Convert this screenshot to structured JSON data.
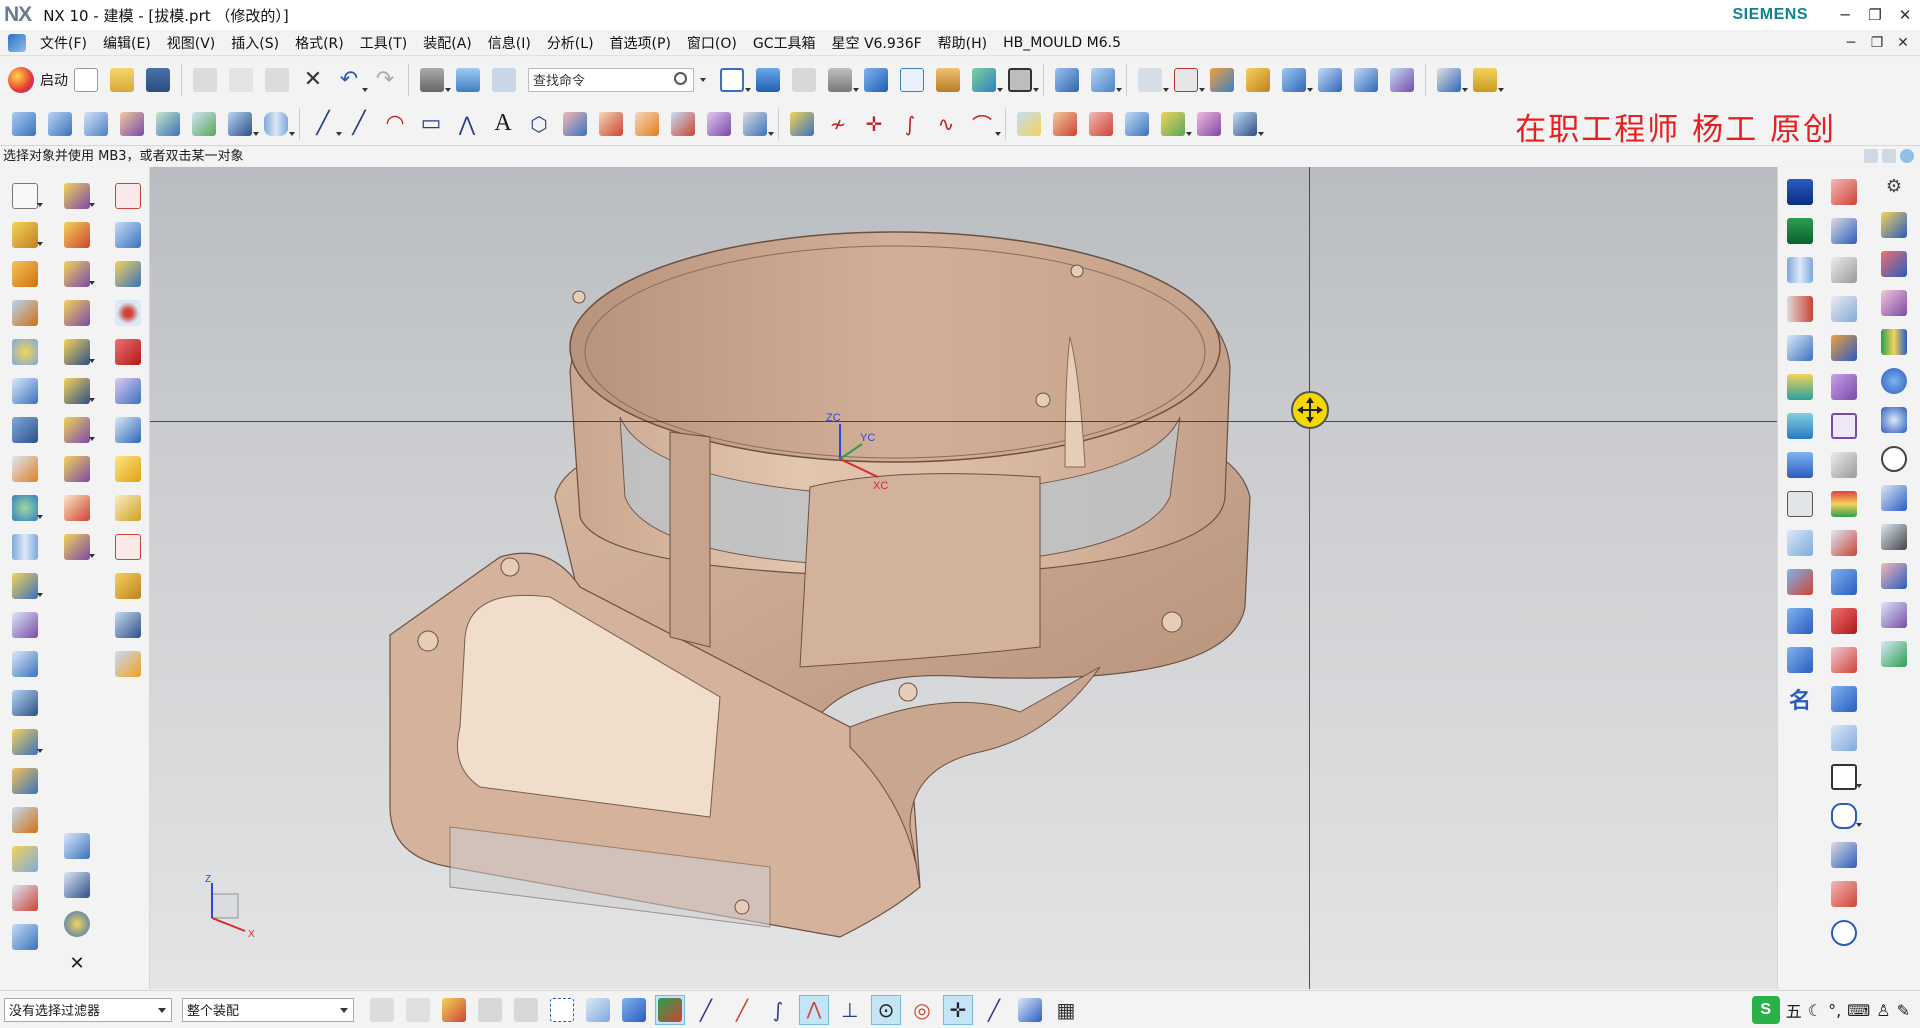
{
  "app": {
    "logo": "NX",
    "window_title": "NX 10 - 建模 - [拔模.prt （修改的）]",
    "brand": "SIEMENS",
    "brand_color": "#10858d"
  },
  "menu": {
    "items": [
      "文件(F)",
      "编辑(E)",
      "视图(V)",
      "插入(S)",
      "格式(R)",
      "工具(T)",
      "装配(A)",
      "信息(I)",
      "分析(L)",
      "首选项(P)",
      "窗口(O)",
      "GC工具箱",
      "星空 V6.936F",
      "帮助(H)",
      "HB_MOULD M6.5"
    ]
  },
  "toolbar": {
    "start_label": "启动",
    "search_placeholder": "查找命令"
  },
  "watermark": "在职工程师 杨工 原创",
  "status": {
    "prompt": "选择对象并使用 MB3，或者双击某一对象"
  },
  "viewport": {
    "triad": {
      "zc": "ZC",
      "yc": "YC",
      "xc": "XC"
    },
    "mini_triad": {
      "z": "Z",
      "x": "X"
    },
    "model_color": "#d9b8a0",
    "accent_cursor": "#f5d800"
  },
  "bottom": {
    "filter_value": "没有选择过滤器",
    "scope_value": "整个装配"
  },
  "ime": {
    "logo": "S",
    "mode": "五"
  },
  "icons": {
    "window_controls": [
      "minimize-icon",
      "restore-icon",
      "close-icon"
    ]
  }
}
